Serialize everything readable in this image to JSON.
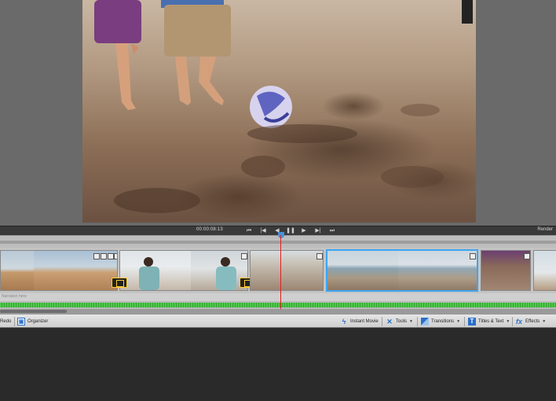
{
  "transport": {
    "timecode": "00:00:08:13",
    "buttons": [
      {
        "name": "go-to-previous-edit-icon",
        "glyph": "⏮"
      },
      {
        "name": "previous-frame-icon",
        "glyph": "|◀"
      },
      {
        "name": "rewind-icon",
        "glyph": "◀"
      },
      {
        "name": "pause-icon",
        "glyph": "❚❚"
      },
      {
        "name": "forward-icon",
        "glyph": "▶"
      },
      {
        "name": "next-frame-icon",
        "glyph": "▶|"
      },
      {
        "name": "go-to-next-edit-icon",
        "glyph": "⏭"
      }
    ],
    "render_label": "Render"
  },
  "timeline": {
    "narration_label": "Narration here",
    "playhead_color": "#e02020",
    "selected_clip_color": "#3da5f2"
  },
  "toolbar": {
    "redo_label": "Redo",
    "organizer_label": "Organizer",
    "instant_movie_label": "Instant Movie",
    "tools_label": "Tools",
    "transitions_label": "Transitions",
    "titles_label": "Titles & Text",
    "effects_label": "Effects"
  }
}
